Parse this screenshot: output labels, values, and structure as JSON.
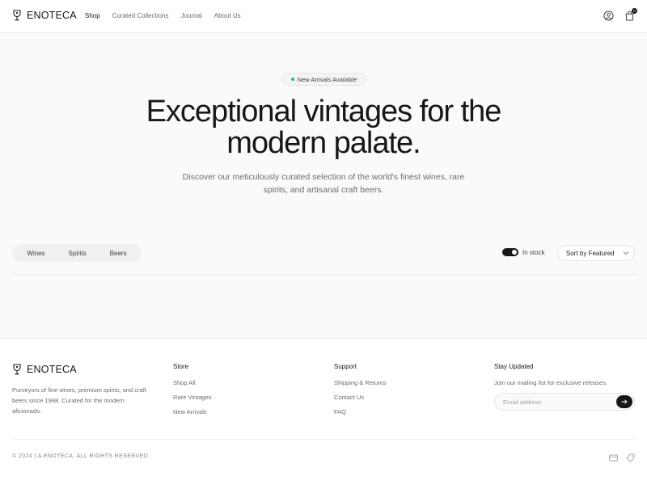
{
  "header": {
    "brand": "ENOTECA",
    "nav": [
      {
        "label": "Shop",
        "active": true
      },
      {
        "label": "Curated Collections",
        "active": false
      },
      {
        "label": "Journal",
        "active": false
      },
      {
        "label": "About Us",
        "active": false
      }
    ],
    "account_icon": "user-circle-icon",
    "cart_icon": "shopping-bag-icon",
    "cart_count": "0"
  },
  "hero": {
    "badge": "New Arrivals Available",
    "title_line1": "Exceptional vintages for the",
    "title_line2": "modern palate.",
    "subtitle": "Discover our meticulously curated selection of the world's finest wines, rare spirits, and artisanal craft beers."
  },
  "filters": {
    "categories": [
      "Wines",
      "Spirits",
      "Beers"
    ],
    "in_stock_label": "In stock",
    "in_stock_enabled": true,
    "sort_label": "Sort by Featured"
  },
  "footer": {
    "brand": "ENOTECA",
    "description": "Purveyors of fine wines, premium spirits, and craft beers since 1998. Curated for the modern aficionado.",
    "store": {
      "heading": "Store",
      "links": [
        "Shop All",
        "Rare Vintages",
        "New Arrivals"
      ]
    },
    "support": {
      "heading": "Support",
      "links": [
        "Shipping & Returns",
        "Contact Us",
        "FAQ"
      ]
    },
    "newsletter": {
      "heading": "Stay Updated",
      "text": "Join our mailing list for exclusive releases.",
      "placeholder": "Email address"
    },
    "copyright": "© 2024 LA ENOTECA. ALL RIGHTS RESERVED.",
    "payment_icons": [
      "credit-card-icon",
      "tag-icon"
    ]
  },
  "colors": {
    "accent": "#171717",
    "status_dot": "#22c55e",
    "background": "#fafafa"
  }
}
